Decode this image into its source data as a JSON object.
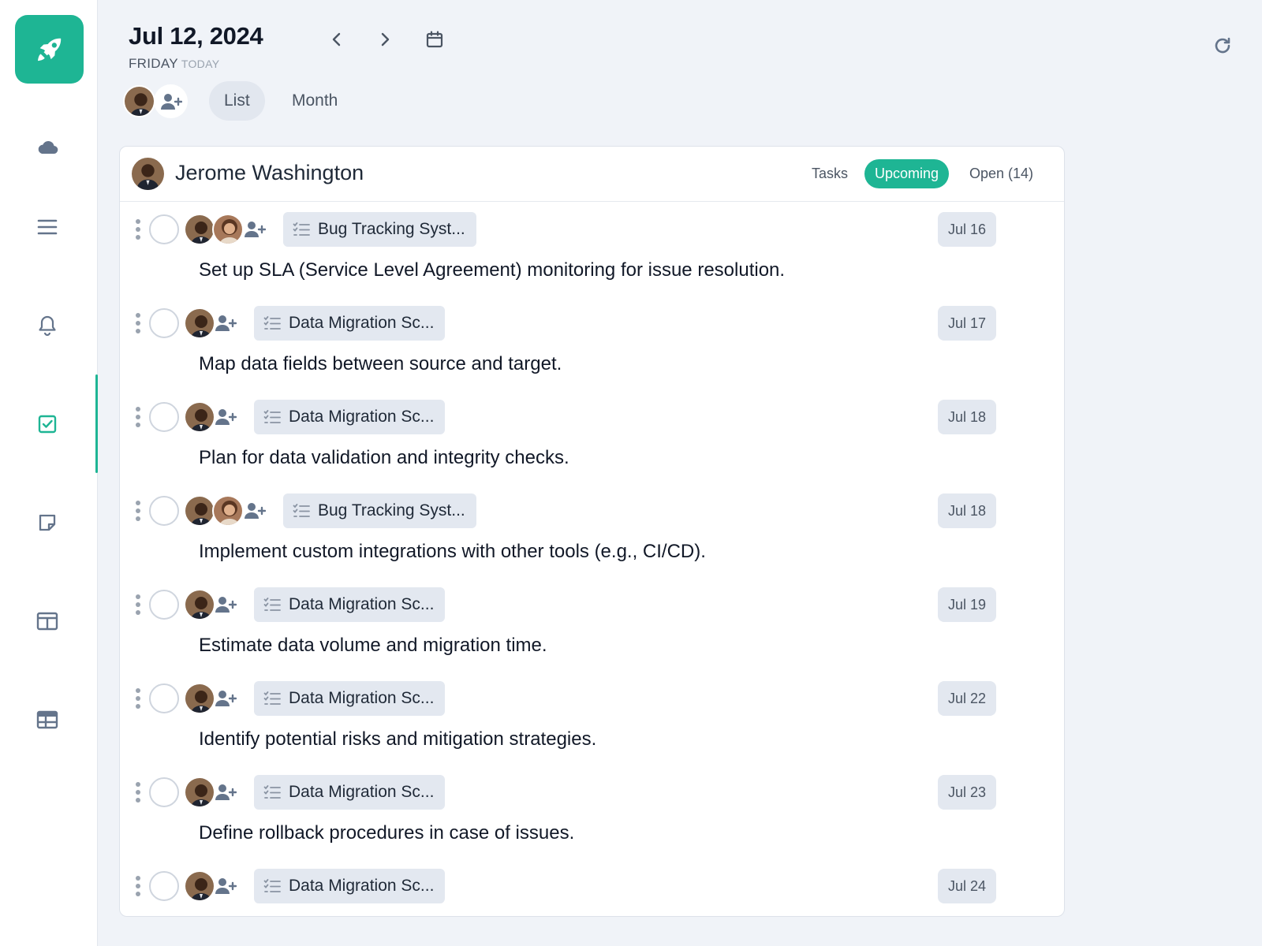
{
  "header": {
    "date": "Jul 12, 2024",
    "weekday": "FRIDAY",
    "today_label": "TODAY"
  },
  "view_tabs": [
    {
      "label": "List",
      "active": true
    },
    {
      "label": "Month",
      "active": false
    }
  ],
  "sidebar": {
    "items": [
      {
        "icon": "cloud-icon"
      },
      {
        "icon": "menu-icon"
      },
      {
        "icon": "bell-icon"
      },
      {
        "icon": "checkbox-icon",
        "active": true
      },
      {
        "icon": "note-icon"
      },
      {
        "icon": "columns-icon"
      },
      {
        "icon": "table-icon"
      }
    ],
    "accent": "#1eb594"
  },
  "card": {
    "owner": "Jerome Washington",
    "filters": [
      {
        "label": "Tasks",
        "active": false
      },
      {
        "label": "Upcoming",
        "active": true
      },
      {
        "label": "Open (14)",
        "active": false
      }
    ]
  },
  "tasks": [
    {
      "project": "Bug Tracking Syst...",
      "due": "Jul 16",
      "title": "Set up SLA (Service Level Agreement) monitoring for issue resolution.",
      "assignees": 2
    },
    {
      "project": "Data Migration Sc...",
      "due": "Jul 17",
      "title": "Map data fields between source and target.",
      "assignees": 1
    },
    {
      "project": "Data Migration Sc...",
      "due": "Jul 18",
      "title": "Plan for data validation and integrity checks.",
      "assignees": 1
    },
    {
      "project": "Bug Tracking Syst...",
      "due": "Jul 18",
      "title": "Implement custom integrations with other tools (e.g., CI/CD).",
      "assignees": 2
    },
    {
      "project": "Data Migration Sc...",
      "due": "Jul 19",
      "title": "Estimate data volume and migration time.",
      "assignees": 1
    },
    {
      "project": "Data Migration Sc...",
      "due": "Jul 22",
      "title": "Identify potential risks and mitigation strategies.",
      "assignees": 1
    },
    {
      "project": "Data Migration Sc...",
      "due": "Jul 23",
      "title": "Define rollback procedures in case of issues.",
      "assignees": 1
    },
    {
      "project": "Data Migration Sc...",
      "due": "Jul 24",
      "title": "",
      "assignees": 1
    }
  ]
}
